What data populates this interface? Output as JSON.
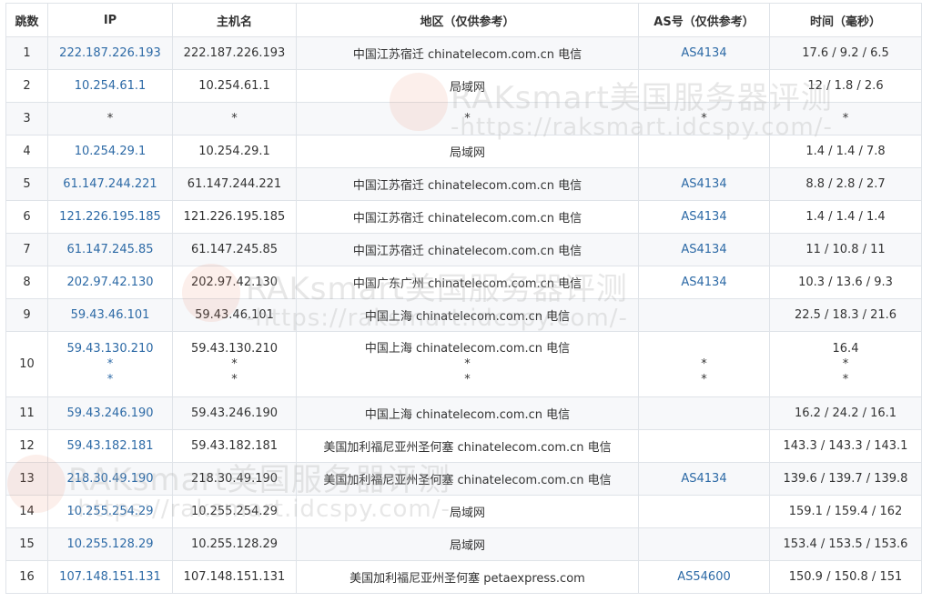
{
  "headers": [
    "跳数",
    "IP",
    "主机名",
    "地区（仅供参考）",
    "AS号（仅供参考）",
    "时间（毫秒）"
  ],
  "rows": [
    {
      "hop": "1",
      "ip": [
        "222.187.226.193"
      ],
      "host": [
        "222.187.226.193"
      ],
      "region": [
        "中国江苏宿迁 chinatelecom.com.cn 电信"
      ],
      "as": [
        "AS4134"
      ],
      "time": [
        "17.6 / 9.2 / 6.5"
      ]
    },
    {
      "hop": "2",
      "ip": [
        "10.254.61.1"
      ],
      "host": [
        "10.254.61.1"
      ],
      "region": [
        "局域网"
      ],
      "as": [
        ""
      ],
      "time": [
        "12 / 1.8 / 2.6"
      ]
    },
    {
      "hop": "3",
      "ip": [
        "*"
      ],
      "host": [
        "*"
      ],
      "region": [
        "*"
      ],
      "as": [
        "*"
      ],
      "time": [
        "*"
      ]
    },
    {
      "hop": "4",
      "ip": [
        "10.254.29.1"
      ],
      "host": [
        "10.254.29.1"
      ],
      "region": [
        "局域网"
      ],
      "as": [
        ""
      ],
      "time": [
        "1.4 / 1.4 / 7.8"
      ]
    },
    {
      "hop": "5",
      "ip": [
        "61.147.244.221"
      ],
      "host": [
        "61.147.244.221"
      ],
      "region": [
        "中国江苏宿迁 chinatelecom.com.cn 电信"
      ],
      "as": [
        "AS4134"
      ],
      "time": [
        "8.8 / 2.8 / 2.7"
      ]
    },
    {
      "hop": "6",
      "ip": [
        "121.226.195.185"
      ],
      "host": [
        "121.226.195.185"
      ],
      "region": [
        "中国江苏宿迁 chinatelecom.com.cn 电信"
      ],
      "as": [
        "AS4134"
      ],
      "time": [
        "1.4 / 1.4 / 1.4"
      ]
    },
    {
      "hop": "7",
      "ip": [
        "61.147.245.85"
      ],
      "host": [
        "61.147.245.85"
      ],
      "region": [
        "中国江苏宿迁 chinatelecom.com.cn 电信"
      ],
      "as": [
        "AS4134"
      ],
      "time": [
        "11 / 10.8 / 11"
      ]
    },
    {
      "hop": "8",
      "ip": [
        "202.97.42.130"
      ],
      "host": [
        "202.97.42.130"
      ],
      "region": [
        "中国广东广州 chinatelecom.com.cn 电信"
      ],
      "as": [
        "AS4134"
      ],
      "time": [
        "10.3 / 13.6 / 9.3"
      ]
    },
    {
      "hop": "9",
      "ip": [
        "59.43.46.101"
      ],
      "host": [
        "59.43.46.101"
      ],
      "region": [
        "中国上海 chinatelecom.com.cn 电信"
      ],
      "as": [
        ""
      ],
      "time": [
        "22.5 / 18.3 / 21.6"
      ]
    },
    {
      "hop": "10",
      "ip": [
        "59.43.130.210",
        "*",
        "*"
      ],
      "host": [
        "59.43.130.210",
        "*",
        "*"
      ],
      "region": [
        "中国上海 chinatelecom.com.cn 电信",
        "*",
        "*"
      ],
      "as": [
        "",
        "*",
        "*"
      ],
      "time": [
        "16.4",
        "*",
        "*"
      ]
    },
    {
      "hop": "11",
      "ip": [
        "59.43.246.190"
      ],
      "host": [
        "59.43.246.190"
      ],
      "region": [
        "中国上海 chinatelecom.com.cn 电信"
      ],
      "as": [
        ""
      ],
      "time": [
        "16.2 / 24.2 / 16.1"
      ]
    },
    {
      "hop": "12",
      "ip": [
        "59.43.182.181"
      ],
      "host": [
        "59.43.182.181"
      ],
      "region": [
        "美国加利福尼亚州圣何塞 chinatelecom.com.cn 电信"
      ],
      "as": [
        ""
      ],
      "time": [
        "143.3 / 143.3 / 143.1"
      ]
    },
    {
      "hop": "13",
      "ip": [
        "218.30.49.190"
      ],
      "host": [
        "218.30.49.190"
      ],
      "region": [
        "美国加利福尼亚州圣何塞 chinatelecom.com.cn 电信"
      ],
      "as": [
        "AS4134"
      ],
      "time": [
        "139.6 / 139.7 / 139.8"
      ]
    },
    {
      "hop": "14",
      "ip": [
        "10.255.254.29"
      ],
      "host": [
        "10.255.254.29"
      ],
      "region": [
        "局域网"
      ],
      "as": [
        ""
      ],
      "time": [
        "159.1 / 159.4 / 162"
      ]
    },
    {
      "hop": "15",
      "ip": [
        "10.255.128.29"
      ],
      "host": [
        "10.255.128.29"
      ],
      "region": [
        "局域网"
      ],
      "as": [
        ""
      ],
      "time": [
        "153.4 / 153.5 / 153.6"
      ]
    },
    {
      "hop": "16",
      "ip": [
        "107.148.151.131"
      ],
      "host": [
        "107.148.151.131"
      ],
      "region": [
        "美国加利福尼亚州圣何塞 petaexpress.com"
      ],
      "as": [
        "AS54600"
      ],
      "time": [
        "150.9 / 150.8 / 151"
      ]
    }
  ],
  "watermark": {
    "line1": "RAKsmart美国服务器评测",
    "line2": "-https://raksmart.idcspy.com/-"
  },
  "colors": {
    "link": "#2d6aa6",
    "border": "#dfe3e8",
    "stripe": "#f7f8fa"
  }
}
